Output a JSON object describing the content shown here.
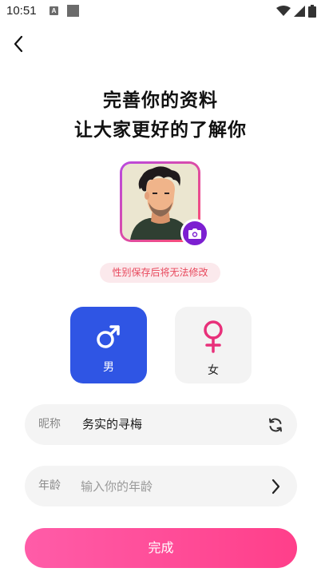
{
  "status_bar": {
    "time": "10:51",
    "notification_icon_letter": "A"
  },
  "header": {
    "back_icon": "chevron-left-icon",
    "title_line1": "完善你的资料",
    "title_line2": "让大家更好的了解你"
  },
  "avatar": {
    "camera_icon": "camera-icon",
    "border_gradient": [
      "#b84ae0",
      "#ff4d6d"
    ],
    "camera_color": "#7c1fd1"
  },
  "warning_text": "性别保存后将无法修改",
  "gender": {
    "selected": "male",
    "male_label": "男",
    "female_label": "女",
    "male_color": "#2f55e4",
    "female_icon_color": "#e8307a"
  },
  "form": {
    "nickname_label": "昵称",
    "nickname_value": "务实的寻梅",
    "nickname_action_icon": "refresh-icon",
    "age_label": "年龄",
    "age_placeholder": "输入你的年龄",
    "age_action_icon": "chevron-right-icon"
  },
  "submit_label": "完成",
  "colors": {
    "accent_pink": "#ff3f8a",
    "warning_text": "#e8485c",
    "warning_bg": "#fbe9ec"
  }
}
